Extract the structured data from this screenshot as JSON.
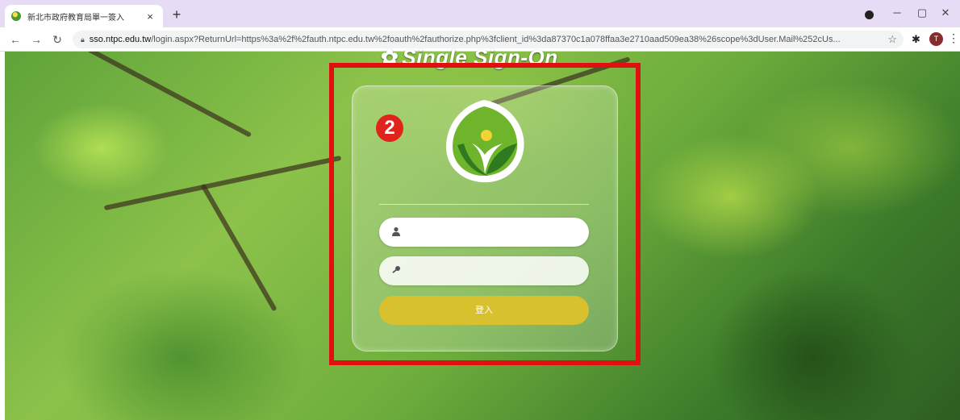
{
  "browser": {
    "tab_title": "新北市政府教育局單一簽入",
    "tab_close": "×",
    "new_tab": "+",
    "minimize": "─",
    "maximize": "▢",
    "close": "✕",
    "url_host": "sso.ntpc.edu.tw",
    "url_rest": "/login.aspx?ReturnUrl=https%3a%2f%2fauth.ntpc.edu.tw%2foauth%2fauthorize.php%3fclient_id%3da87370c1a078ffaa3e2710aad509ea38%26scope%3dUser.Mail%252cUs...",
    "profile_initial": "T",
    "colors": {
      "tab_strip": "#e7dcf5"
    }
  },
  "page": {
    "header_title": "Single Sign-On",
    "step_number": "2",
    "login_button_label": "登入",
    "username": {
      "value": "",
      "placeholder": ""
    },
    "password": {
      "value": "",
      "placeholder": ""
    },
    "colors": {
      "highlight": "#e01010",
      "badge": "#e0241b",
      "button": "#d9c02f"
    },
    "icons": [
      "user-icon",
      "key-icon",
      "leaf-logo",
      "gear-icon"
    ]
  }
}
